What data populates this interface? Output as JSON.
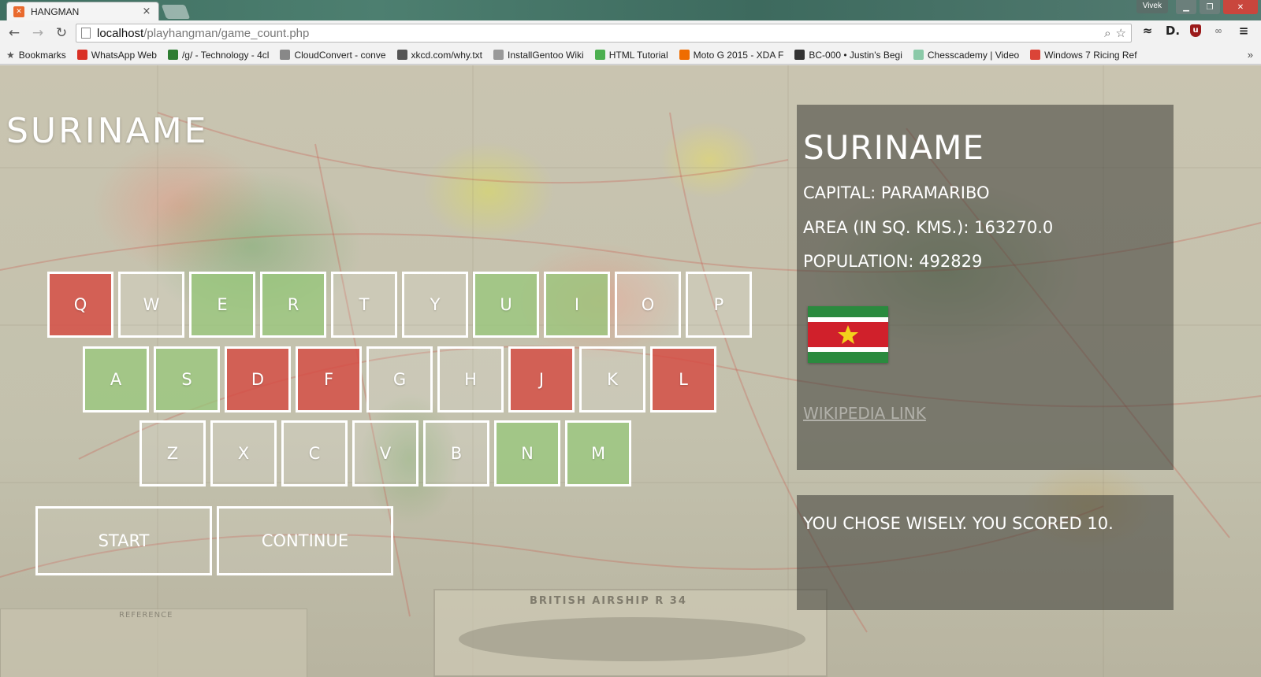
{
  "browser": {
    "tab": {
      "title": "HANGMAN",
      "favicon": "xampp-icon",
      "close": "×"
    },
    "window": {
      "user": "Vivek",
      "minimize": "▁",
      "maximize": "❐",
      "close": "✕"
    },
    "nav": {
      "back": "←",
      "forward": "→",
      "reload": "↻"
    },
    "address": {
      "host": "localhost",
      "path": "/playhangman/game_count.php"
    },
    "bookmarks_label": "Bookmarks",
    "bookmarks": [
      {
        "label": "WhatsApp Web",
        "icon": "warning-icon",
        "color": "#d93025"
      },
      {
        "label": "/g/ - Technology - 4cl",
        "icon": "clover-icon",
        "color": "#2e7d32"
      },
      {
        "label": "CloudConvert - conve",
        "icon": "cloud-icon",
        "color": "#888888"
      },
      {
        "label": "xkcd.com/why.txt",
        "icon": "xkcd-icon",
        "color": "#555555"
      },
      {
        "label": "InstallGentoo Wiki",
        "icon": "page-icon",
        "color": "#999999"
      },
      {
        "label": "HTML Tutorial",
        "icon": "w3-icon",
        "color": "#4caf50"
      },
      {
        "label": "Moto G 2015 - XDA F",
        "icon": "xda-icon",
        "color": "#ef6c00"
      },
      {
        "label": "BC-000 • Justin's Begi",
        "icon": "loop-icon",
        "color": "#333333"
      },
      {
        "label": "Chesscademy | Video",
        "icon": "chess-icon",
        "color": "#8bc9a8"
      },
      {
        "label": "Windows 7 Ricing Ref",
        "icon": "chrome-icon",
        "color": "#db4437"
      }
    ],
    "bookmarks_more": "»"
  },
  "game": {
    "word": "SURINAME",
    "keyboard": {
      "row1": [
        {
          "letter": "Q",
          "state": "wrong"
        },
        {
          "letter": "W",
          "state": "unused"
        },
        {
          "letter": "E",
          "state": "right"
        },
        {
          "letter": "R",
          "state": "right"
        },
        {
          "letter": "T",
          "state": "unused"
        },
        {
          "letter": "Y",
          "state": "unused"
        },
        {
          "letter": "U",
          "state": "right"
        },
        {
          "letter": "I",
          "state": "right"
        },
        {
          "letter": "O",
          "state": "unused"
        },
        {
          "letter": "P",
          "state": "unused"
        }
      ],
      "row2": [
        {
          "letter": "A",
          "state": "right"
        },
        {
          "letter": "S",
          "state": "right"
        },
        {
          "letter": "D",
          "state": "wrong"
        },
        {
          "letter": "F",
          "state": "wrong"
        },
        {
          "letter": "G",
          "state": "unused"
        },
        {
          "letter": "H",
          "state": "unused"
        },
        {
          "letter": "J",
          "state": "wrong"
        },
        {
          "letter": "K",
          "state": "unused"
        },
        {
          "letter": "L",
          "state": "wrong"
        }
      ],
      "row3": [
        {
          "letter": "Z",
          "state": "unused"
        },
        {
          "letter": "X",
          "state": "unused"
        },
        {
          "letter": "C",
          "state": "unused"
        },
        {
          "letter": "V",
          "state": "unused"
        },
        {
          "letter": "B",
          "state": "unused"
        },
        {
          "letter": "N",
          "state": "right"
        },
        {
          "letter": "M",
          "state": "right"
        }
      ]
    },
    "buttons": {
      "start": "START",
      "continue": "CONTINUE"
    }
  },
  "info": {
    "country": "SURINAME",
    "capital": "CAPITAL: PARAMARIBO",
    "area": "AREA (IN SQ. KMS.): 163270.0",
    "population": "POPULATION: 492829",
    "wiki_link": "WIKIPEDIA LINK",
    "flag_colors": {
      "green": "#2a8a3e",
      "white": "#ffffff",
      "red": "#d0202b",
      "star": "#f3d21c"
    }
  },
  "message": "YOU CHOSE WISELY. YOU SCORED 10.",
  "background_map": {
    "airship_caption": "BRITISH AIRSHIP R 34",
    "legend_caption": "REFERENCE"
  },
  "colors": {
    "wrong": "#d64a42",
    "right": "#96c878",
    "panel": "#3c3c37"
  }
}
